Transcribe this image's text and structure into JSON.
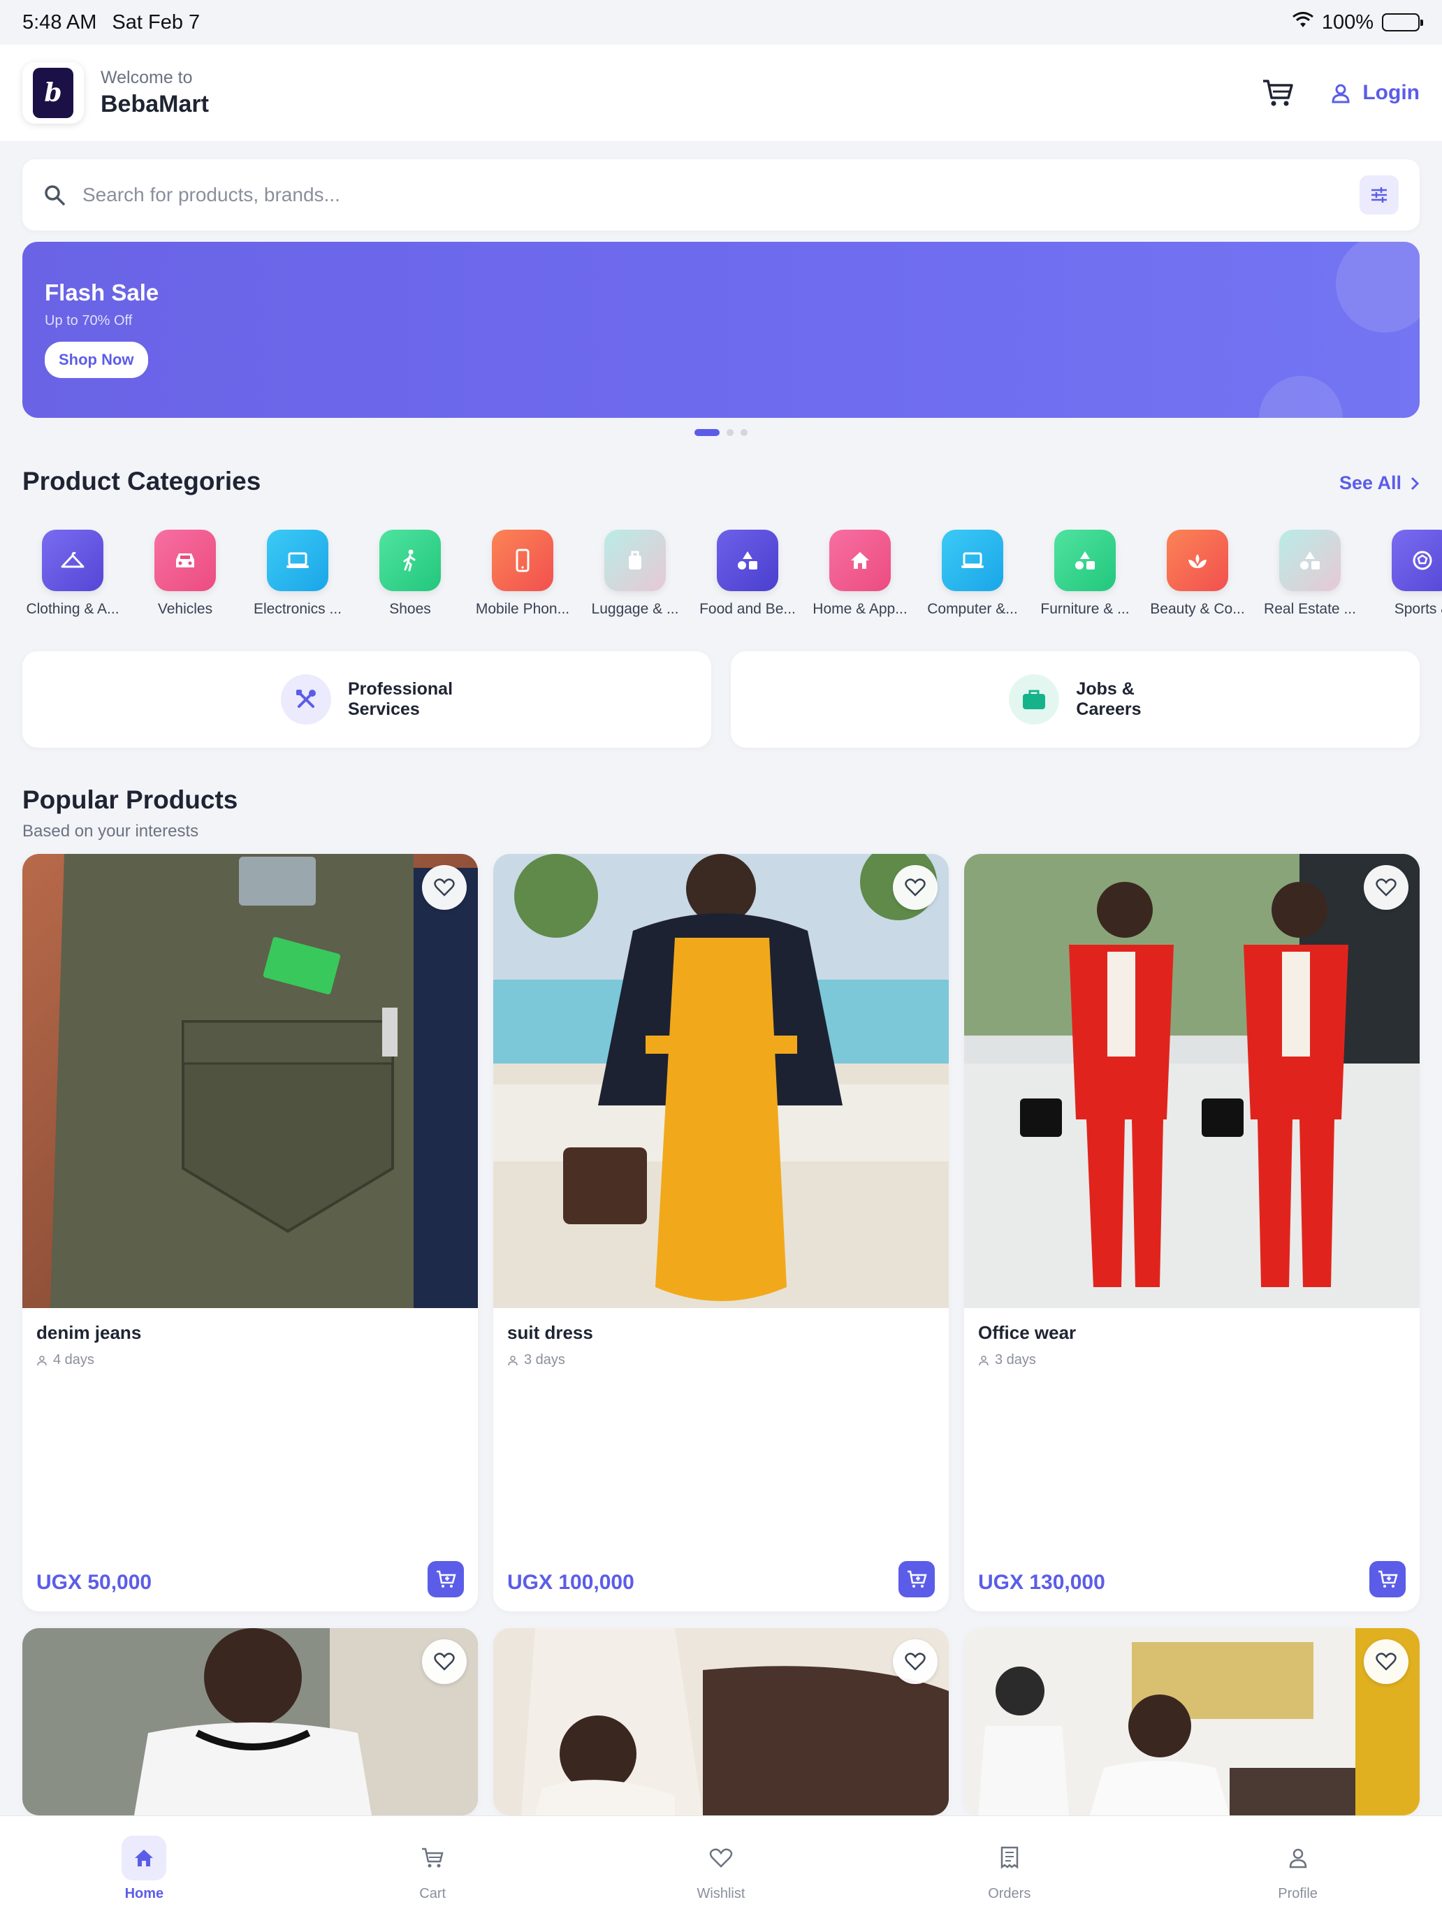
{
  "status_bar": {
    "time": "5:48 AM",
    "date": "Sat Feb 7",
    "battery": "100%"
  },
  "header": {
    "welcome": "Welcome to",
    "app_name": "BebaMart",
    "login_label": "Login",
    "logo_text": "b"
  },
  "search": {
    "placeholder": "Search for products, brands..."
  },
  "banner": {
    "title": "Flash Sale",
    "subtitle": "Up to 70% Off",
    "button": "Shop Now",
    "active_slide": 1,
    "slides": 3
  },
  "categories_section": {
    "title": "Product Categories",
    "see_all": "See All",
    "items": [
      {
        "label": "Clothing & A...",
        "icon": "hanger-icon",
        "color": "#6a5be0"
      },
      {
        "label": "Vehicles",
        "icon": "car-icon",
        "color": "#f0588f"
      },
      {
        "label": "Electronics ...",
        "icon": "laptop-icon",
        "color": "#22b7f0"
      },
      {
        "label": "Shoes",
        "icon": "walking-icon",
        "color": "#33d58c"
      },
      {
        "label": "Mobile Phon...",
        "icon": "phone-icon",
        "color": "#f5644f"
      },
      {
        "label": "Luggage & ...",
        "icon": "luggage-icon",
        "color": "#a9e3df"
      },
      {
        "label": "Food and Be...",
        "icon": "shapes-icon",
        "color": "#5b4fd6"
      },
      {
        "label": "Home & App...",
        "icon": "home-icon",
        "color": "#f0588f"
      },
      {
        "label": "Computer &...",
        "icon": "laptop-icon",
        "color": "#22b7f0"
      },
      {
        "label": "Furniture & ...",
        "icon": "shapes-icon",
        "color": "#33d58c"
      },
      {
        "label": "Beauty & Co...",
        "icon": "lotus-icon",
        "color": "#f5644f"
      },
      {
        "label": "Real Estate ...",
        "icon": "shapes-icon",
        "color": "#a9e3df"
      },
      {
        "label": "Sports &",
        "icon": "ball-icon",
        "color": "#6a5be0"
      }
    ]
  },
  "services": [
    {
      "label_line1": "Professional",
      "label_line2": "Services",
      "icon": "tools-icon",
      "color": "#5b5de8"
    },
    {
      "label_line1": "Jobs &",
      "label_line2": "Careers",
      "icon": "briefcase-icon",
      "color": "#16b38a"
    }
  ],
  "popular": {
    "title": "Popular Products",
    "subtitle": "Based on your interests",
    "products": [
      {
        "name": "denim jeans",
        "age": "4 days",
        "price": "UGX 50,000"
      },
      {
        "name": "suit dress",
        "age": "3 days",
        "price": "UGX 100,000"
      },
      {
        "name": "Office wear",
        "age": "3 days",
        "price": "UGX 130,000"
      }
    ]
  },
  "bottom_nav": {
    "items": [
      {
        "label": "Home",
        "icon": "home-icon",
        "active": true
      },
      {
        "label": "Cart",
        "icon": "cart-icon",
        "active": false
      },
      {
        "label": "Wishlist",
        "icon": "heart-icon",
        "active": false
      },
      {
        "label": "Orders",
        "icon": "receipt-icon",
        "active": false
      },
      {
        "label": "Profile",
        "icon": "user-icon",
        "active": false
      }
    ]
  },
  "colors": {
    "accent": "#5b5de8",
    "background": "#f3f4f8"
  }
}
